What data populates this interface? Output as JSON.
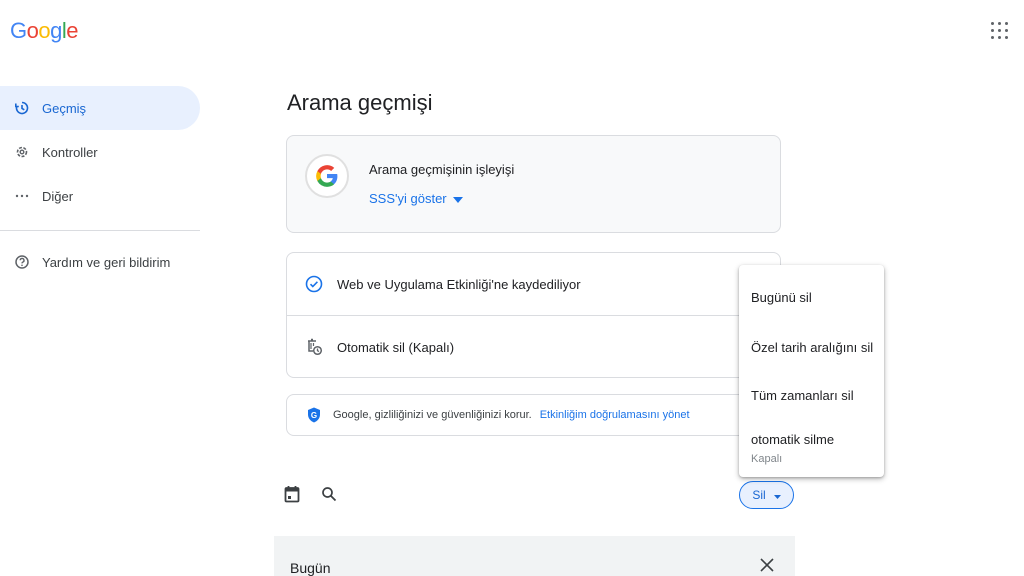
{
  "brand": {
    "logo_letters": [
      "G",
      "o",
      "o",
      "g",
      "l",
      "e"
    ],
    "logo_colors": [
      "#4285F4",
      "#EA4335",
      "#FBBC05",
      "#4285F4",
      "#34A853",
      "#EA4335"
    ]
  },
  "sidebar": {
    "items": [
      {
        "label": "Geçmiş",
        "icon": "history-icon",
        "active": true
      },
      {
        "label": "Kontroller",
        "icon": "gear-icon"
      },
      {
        "label": "Diğer",
        "icon": "more-horizontal-icon"
      }
    ],
    "help": {
      "label": "Yardım ve geri bildirim",
      "icon": "help-icon"
    }
  },
  "main": {
    "title": "Arama geçmişi",
    "info_card": {
      "title": "Arama geçmişinin işleyişi",
      "faq_label": "SSS'yi göster"
    },
    "settings_card": {
      "web_activity": "Web ve Uygulama Etkinliği'ne kaydediliyor",
      "auto_delete": "Otomatik sil (Kapalı)"
    },
    "privacy_card": {
      "text": "Google, gizliliğinizi ve güvenliğinizi korur.",
      "link": "Etkinliğim doğrulamasını yönet"
    },
    "delete_button": "Sil",
    "today_section": "Bugün"
  },
  "delete_menu": {
    "items": [
      "Bugünü sil",
      "Özel tarih aralığını sil",
      "Tüm zamanları sil",
      "otomatik silme"
    ],
    "auto_delete_status": "Kapalı"
  },
  "colors": {
    "accent": "#1a73e8",
    "active_bg": "#e8f0fe"
  }
}
